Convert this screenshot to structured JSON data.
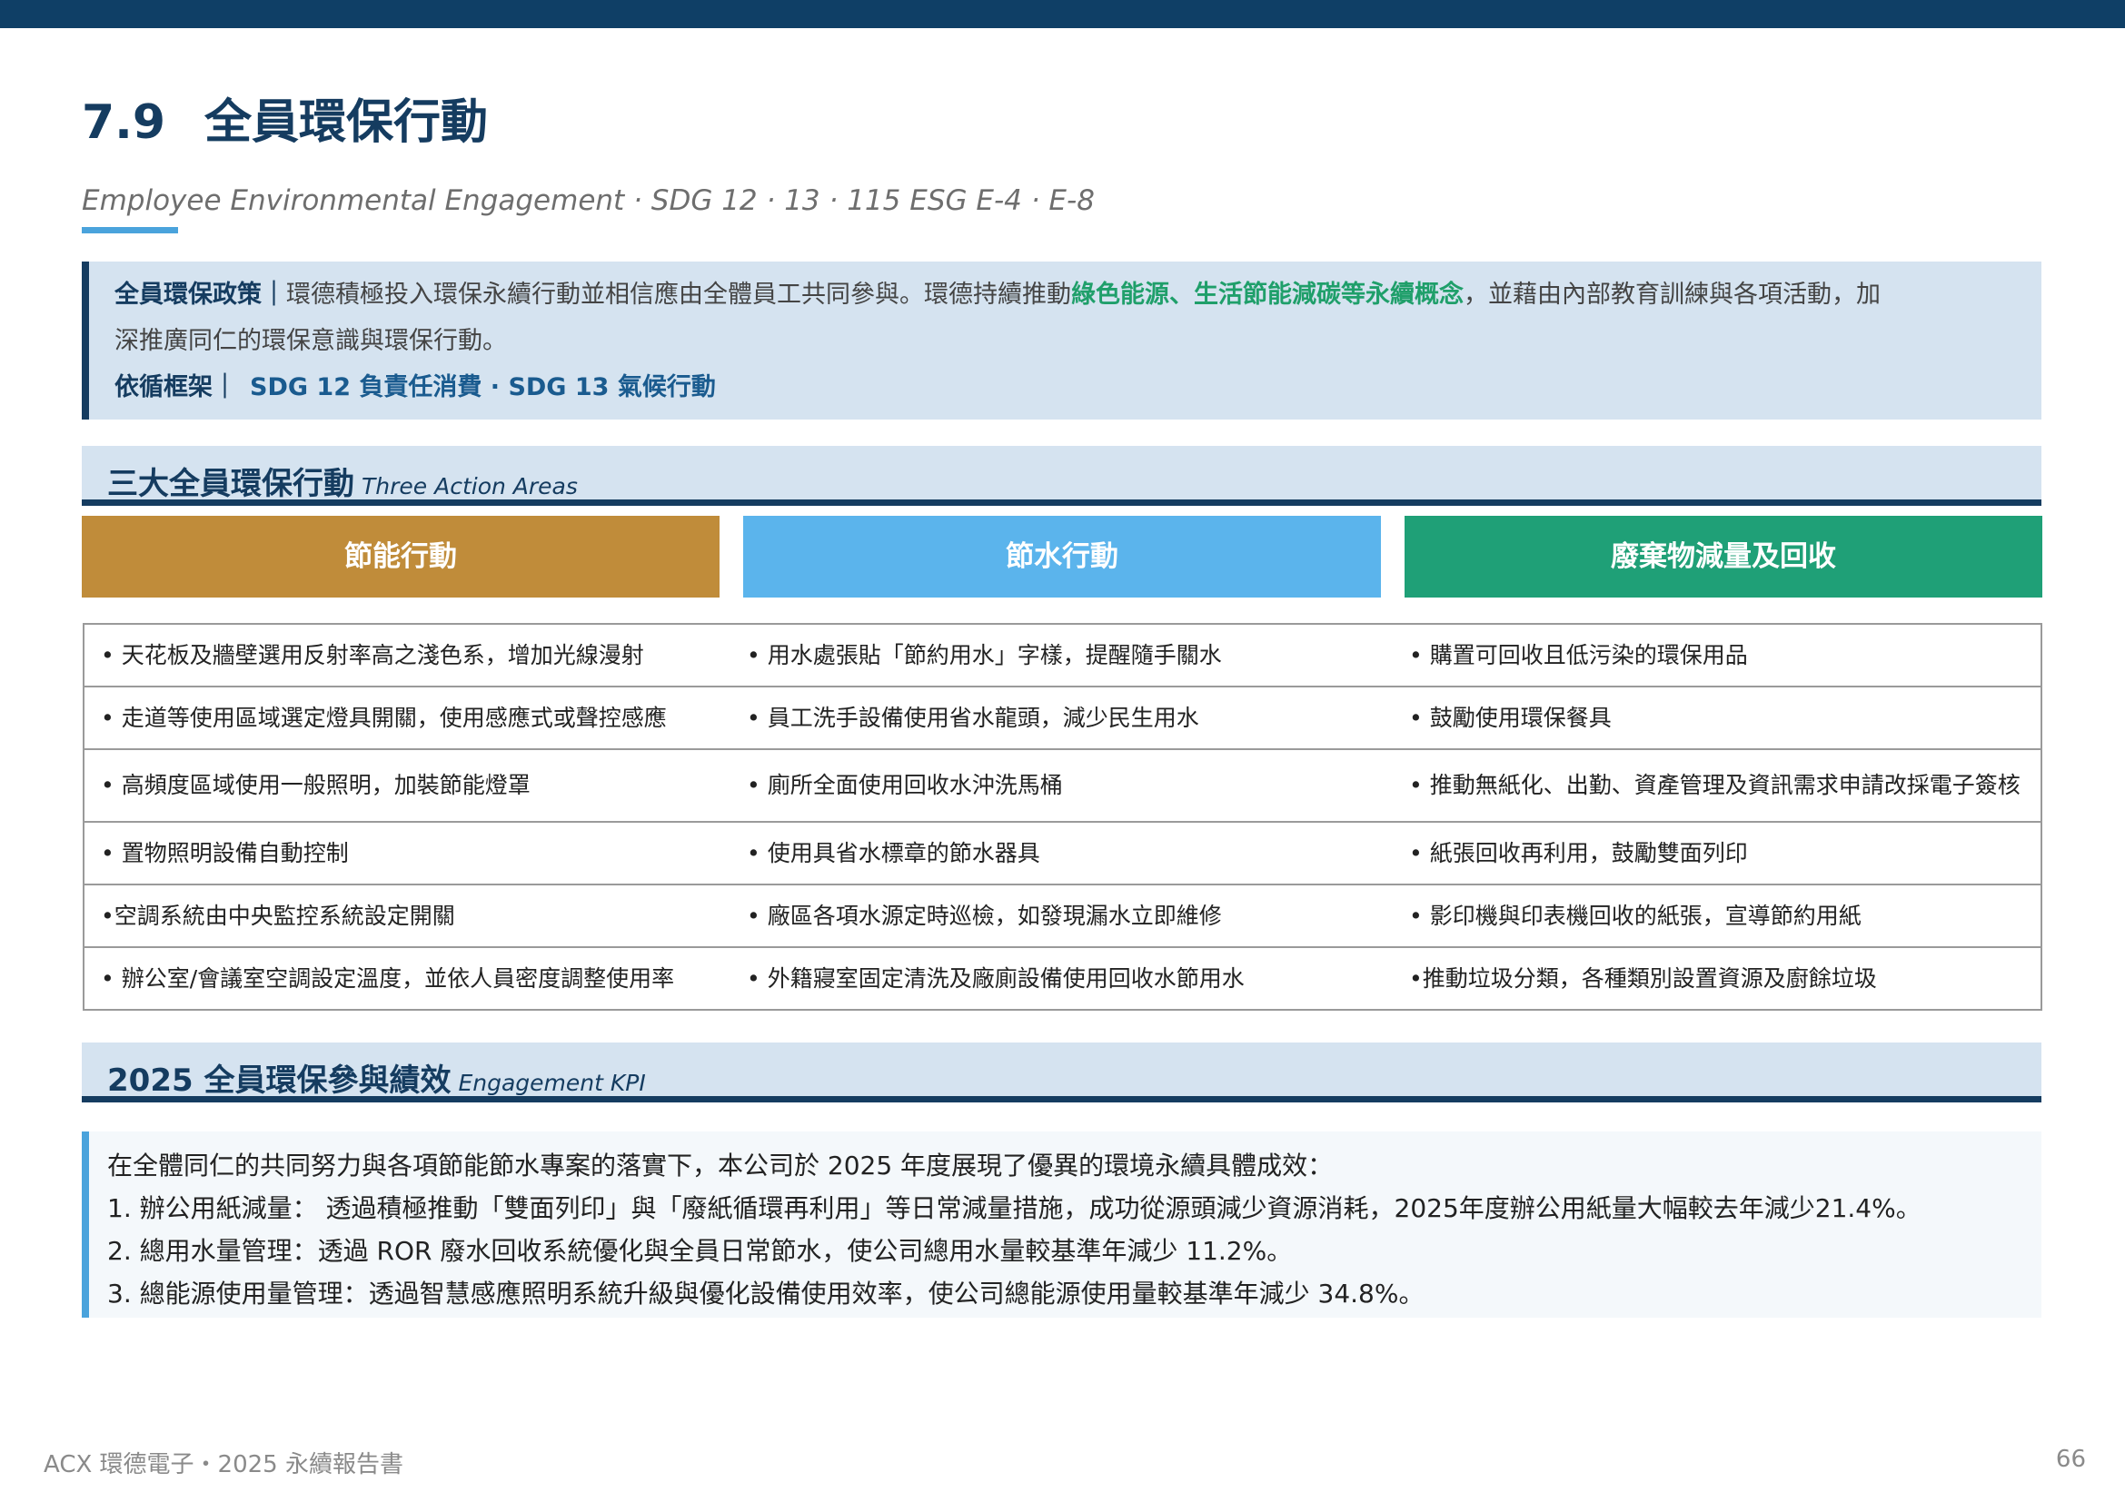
{
  "header": {
    "section_number": "7.9",
    "title": "全員環保行動",
    "subtitle": "Employee Environmental Engagement · SDG 12 · 13 ·  115 ESG E-4 · E-8"
  },
  "policy": {
    "label": "全員環保政策｜",
    "text_a": "環德積極投入環保永續行動並相信應由全體員工共同參與。環德持續推動",
    "highlight": "綠色能源、生活節能減碳等永續概念",
    "text_b": "，並藉由內部教育訓練與各項活動，加",
    "line2": "深推廣同仁的環保意識與環保行動。",
    "framework_label": "依循框架｜",
    "framework_text": "SDG 12 負責任消費 · SDG 13 氣候行動"
  },
  "actions_section": {
    "title_zh": "三大全員環保行動",
    "title_en": "Three Action Areas",
    "columns": [
      {
        "label": "節能行動",
        "color": "#c08c3a"
      },
      {
        "label": "節水行動",
        "color": "#5bb4ec"
      },
      {
        "label": "廢棄物減量及回收",
        "color": "#1fa077"
      }
    ],
    "rows": [
      [
        "• 天花板及牆壁選用反射率高之淺色系，增加光線漫射",
        "• 用水處張貼「節約用水」字樣，提醒隨手關水",
        "• 購置可回收且低污染的環保用品"
      ],
      [
        "• 走道等使用區域選定燈具開關，使用感應式或聲控感應",
        "• 員工洗手設備使用省水龍頭，減少民生用水",
        "• 鼓勵使用環保餐具"
      ],
      [
        "• 高頻度區域使用一般照明，加裝節能燈罩",
        "• 廁所全面使用回收水沖洗馬桶",
        "• 推動無紙化、出勤、資產管理及資訊需求申請改採電子簽核"
      ],
      [
        "• 置物照明設備自動控制",
        "• 使用具省水標章的節水器具",
        "• 紙張回收再利用，鼓勵雙面列印"
      ],
      [
        "•空調系統由中央監控系統設定開關",
        "• 廠區各項水源定時巡檢，如發現漏水立即維修",
        "• 影印機與印表機回收的紙張，宣導節約用紙"
      ],
      [
        "• 辦公室/會議室空調設定溫度，並依人員密度調整使用率",
        "• 外籍寢室固定清洗及廠廁設備使用回收水節用水",
        "•推動垃圾分類，各種類別設置資源及廚餘垃圾"
      ]
    ]
  },
  "kpi_section": {
    "title_zh": "2025 全員環保參與績效",
    "title_en": "Engagement KPI",
    "intro": "在全體同仁的共同努力與各項節能節水專案的落實下，本公司於 2025 年度展現了優異的環境永續具體成效：",
    "items": [
      "1. 辦公用紙減量： 透過積極推動「雙面列印」與「廢紙循環再利用」等日常減量措施，成功從源頭減少資源消耗，2025年度辦公用紙量大幅較去年減少21.4%。",
      "2. 總用水量管理：透過 ROR 廢水回收系統優化與全員日常節水，使公司總用水量較基準年減少 11.2%。",
      "3. 總能源使用量管理：透過智慧感應照明系統升級與優化設備使用效率，使公司總能源使用量較基準年減少 34.8%。"
    ]
  },
  "footer": {
    "left": "ACX 環德電子・2025 永續報告書",
    "page": "66"
  }
}
